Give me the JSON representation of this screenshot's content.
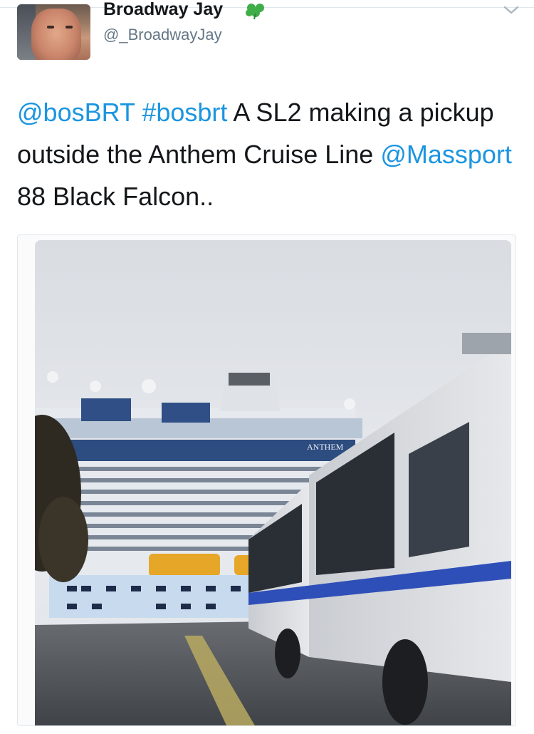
{
  "user": {
    "display_name": "Broadway Jay",
    "handle": "@_BroadwayJay",
    "avatar_icon": "profile-photo",
    "emoji_icon": "shamrock-icon"
  },
  "menu_icon": "chevron-down-icon",
  "tweet": {
    "segments": [
      {
        "text": "@bosBRT",
        "link": true
      },
      {
        "text": " ",
        "link": false
      },
      {
        "text": "#bosbrt",
        "link": true
      },
      {
        "text": " A SL2 making a pickup outside the Anthem Cruise Line ",
        "link": false
      },
      {
        "text": "@Massport",
        "link": true
      },
      {
        "text": " 88 Black Falcon..",
        "link": false
      }
    ]
  },
  "media": {
    "alt": "",
    "ship_name": "ANTHEM"
  },
  "colors": {
    "link": "#1b95e0",
    "text": "#14171a",
    "secondary": "#657786",
    "clover": "#3fae49"
  }
}
